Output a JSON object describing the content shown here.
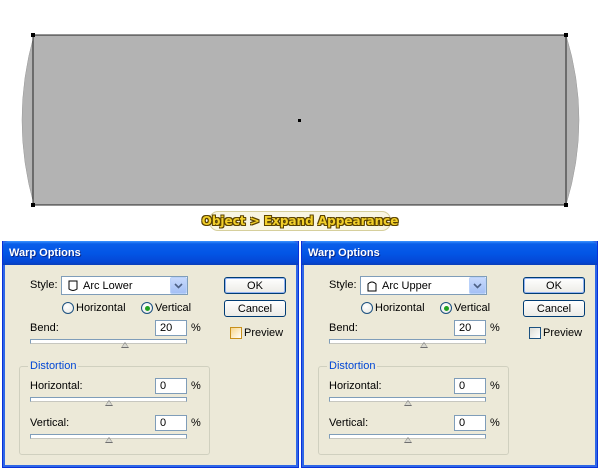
{
  "caption": "Object > Expand Appearance",
  "colors": {
    "shape_fill": "#b3b3b3",
    "titlebar": "#0356e6",
    "dialog_bg": "#ece9d8",
    "group_title": "#0046d5"
  },
  "dialogs": [
    {
      "id": "left",
      "title": "Warp Options",
      "style_label": "Style:",
      "style_value": "Arc Lower",
      "style_icon": "arc-lower-icon",
      "orientation_horizontal": "Horizontal",
      "orientation_vertical": "Vertical",
      "orientation_selected": "vertical",
      "bend_label": "Bend:",
      "bend_value": "20",
      "bend_unit": "%",
      "ok_label": "OK",
      "cancel_label": "Cancel",
      "preview_label": "Preview",
      "preview_checked": false,
      "distortion_title": "Distortion",
      "horizontal_label": "Horizontal:",
      "horizontal_value": "0",
      "horizontal_unit": "%",
      "vertical_label": "Vertical:",
      "vertical_value": "0",
      "vertical_unit": "%"
    },
    {
      "id": "right",
      "title": "Warp Options",
      "style_label": "Style:",
      "style_value": "Arc Upper",
      "style_icon": "arc-upper-icon",
      "orientation_horizontal": "Horizontal",
      "orientation_vertical": "Vertical",
      "orientation_selected": "vertical",
      "bend_label": "Bend:",
      "bend_value": "20",
      "bend_unit": "%",
      "ok_label": "OK",
      "cancel_label": "Cancel",
      "preview_label": "Preview",
      "preview_checked": false,
      "distortion_title": "Distortion",
      "horizontal_label": "Horizontal:",
      "horizontal_value": "0",
      "horizontal_unit": "%",
      "vertical_label": "Vertical:",
      "vertical_value": "0",
      "vertical_unit": "%"
    }
  ]
}
